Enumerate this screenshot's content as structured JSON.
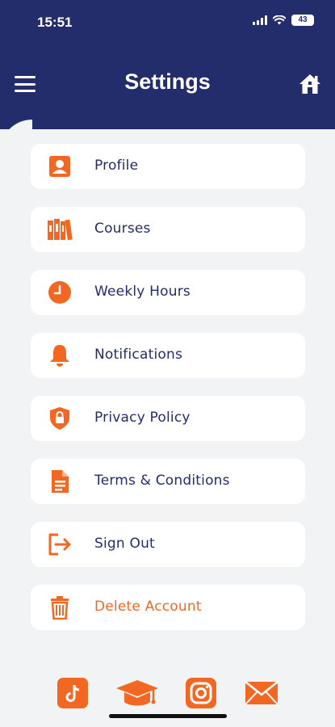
{
  "status_bar": {
    "time": "15:51",
    "battery": "43"
  },
  "header": {
    "title": "Settings",
    "menu_icon": "hamburger-menu-icon",
    "home_icon": "home-icon"
  },
  "colors": {
    "header": "#232d6b",
    "accent": "#f26722",
    "text": "#232d6b",
    "background": "#f2f3f5"
  },
  "settings": {
    "items": [
      {
        "label": "Profile",
        "icon": "profile-icon"
      },
      {
        "label": "Courses",
        "icon": "books-icon"
      },
      {
        "label": "Weekly Hours",
        "icon": "clock-icon"
      },
      {
        "label": "Notifications",
        "icon": "bell-icon"
      },
      {
        "label": "Privacy Policy",
        "icon": "shield-lock-icon"
      },
      {
        "label": "Terms & Conditions",
        "icon": "document-icon"
      },
      {
        "label": "Sign Out",
        "icon": "sign-out-icon"
      },
      {
        "label": "Delete Account",
        "icon": "trash-icon"
      }
    ]
  },
  "social": [
    "tiktok-icon",
    "graduation-cap-icon",
    "instagram-icon",
    "email-icon"
  ]
}
